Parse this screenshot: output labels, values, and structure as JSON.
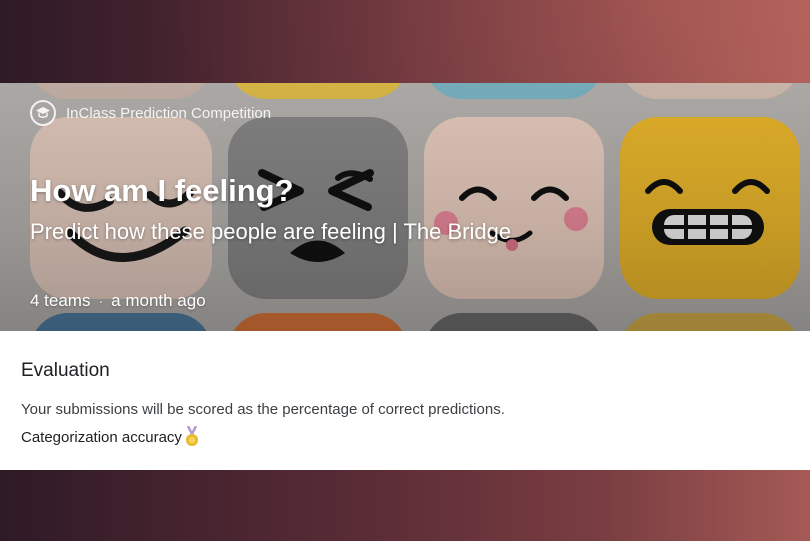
{
  "competition": {
    "type_label": "InClass Prediction Competition",
    "title": "How am I feeling?",
    "subtitle": "Predict how these people are feeling | The Bridge",
    "teams": "4 teams",
    "separator": "·",
    "time_ago": "a month ago"
  },
  "evaluation": {
    "heading": "Evaluation",
    "description": "Your submissions will be scored as the percentage of correct predictions.",
    "metric": "Categorization accuracy"
  },
  "icons": {
    "badge": "graduation-cap-icon",
    "metric": "medal-icon"
  },
  "colors": {
    "page_background": "#5a2c36",
    "card_background": "#ffffff",
    "heading_text": "#202124",
    "body_text": "#3c4043",
    "medal": "#e8b828"
  }
}
